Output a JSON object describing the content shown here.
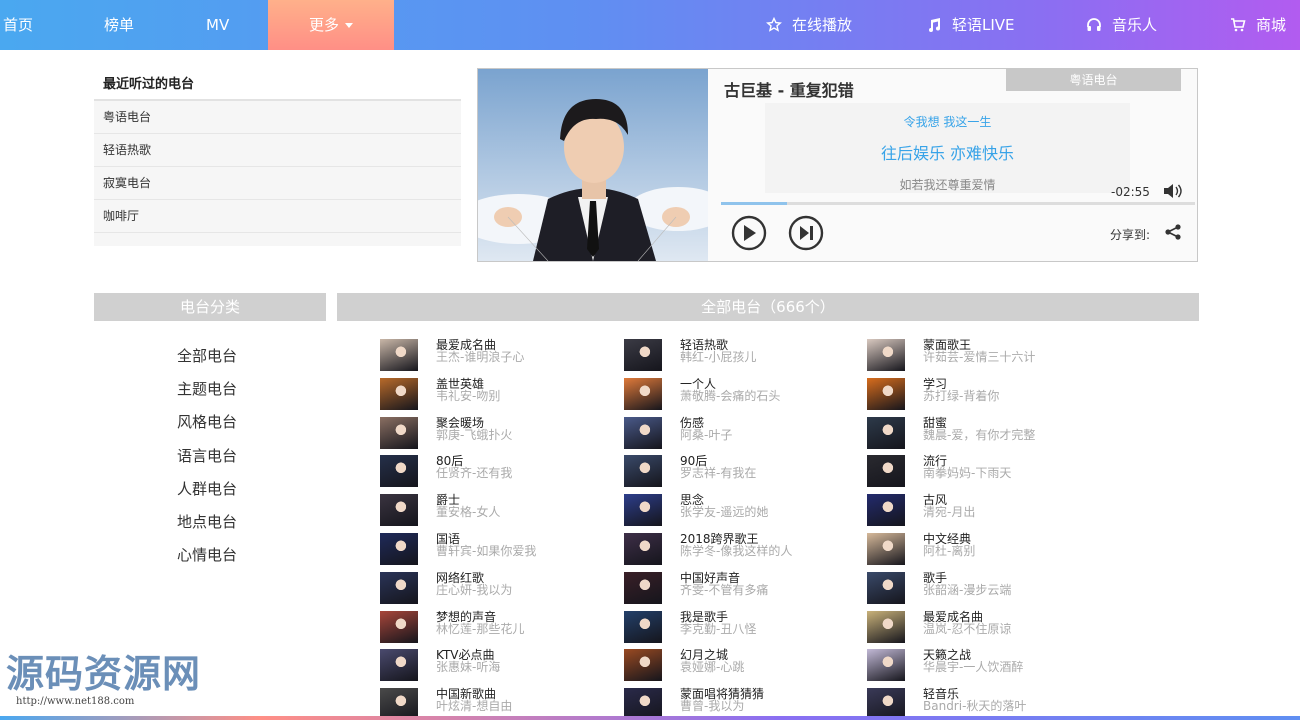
{
  "nav": {
    "home": "首页",
    "charts": "榜单",
    "mv": "MV",
    "more": "更多",
    "online": "在线播放",
    "live": "轻语LIVE",
    "musician": "音乐人",
    "mall": "商城"
  },
  "recent": {
    "title": "最近听过的电台",
    "items": [
      "粤语电台",
      "轻语热歌",
      "寂寞电台",
      "咖啡厅"
    ]
  },
  "player": {
    "song_title": "古巨基 - 重复犯错",
    "station_tag": "粤语电台",
    "lyric_line1": "令我想 我这一生",
    "lyric_line2": "往后娱乐 亦难快乐",
    "lyric_line3": "如若我还尊重爱情",
    "time_remaining": "-02:55",
    "progress_fraction": 0.14,
    "share_label": "分享到:"
  },
  "categories": {
    "title": "电台分类",
    "items": [
      "全部电台",
      "主题电台",
      "风格电台",
      "语言电台",
      "人群电台",
      "地点电台",
      "心情电台"
    ]
  },
  "stations": {
    "title": "全部电台（666个）",
    "items": [
      {
        "name": "最爱成名曲",
        "sub": "王杰-谁明浪子心",
        "tone": "#c9b7a8"
      },
      {
        "name": "轻语热歌",
        "sub": "韩红-小屁孩儿",
        "tone": "#3b3b45"
      },
      {
        "name": "蒙面歌王",
        "sub": "许茹芸-爱情三十六计",
        "tone": "#d9c9c0"
      },
      {
        "name": "盖世英雄",
        "sub": "韦礼安-吻别",
        "tone": "#b86a2a"
      },
      {
        "name": "一个人",
        "sub": "萧敬腾-会痛的石头",
        "tone": "#e07a3a"
      },
      {
        "name": "学习",
        "sub": "苏打绿-背着你",
        "tone": "#d86d1d"
      },
      {
        "name": "聚会暖场",
        "sub": "郭庚-飞蛾扑火",
        "tone": "#8a6f62"
      },
      {
        "name": "伤感",
        "sub": "阿桑-叶子",
        "tone": "#4a5a8a"
      },
      {
        "name": "甜蜜",
        "sub": "魏晨-爱，有你才完整",
        "tone": "#2d3a4a"
      },
      {
        "name": "80后",
        "sub": "任贤齐-还有我",
        "tone": "#25304a"
      },
      {
        "name": "90后",
        "sub": "罗志祥-有我在",
        "tone": "#3a4a6a"
      },
      {
        "name": "流行",
        "sub": "南拳妈妈-下雨天",
        "tone": "#2a2a30"
      },
      {
        "name": "爵士",
        "sub": "董安格-女人",
        "tone": "#3a3440"
      },
      {
        "name": "思念",
        "sub": "张学友-遥远的她",
        "tone": "#2d3e8c"
      },
      {
        "name": "古风",
        "sub": "清宛-月出",
        "tone": "#232b6e"
      },
      {
        "name": "国语",
        "sub": "曹轩宾-如果你爱我",
        "tone": "#1f2a5a"
      },
      {
        "name": "2018跨界歌王",
        "sub": "陈学冬-像我这样的人",
        "tone": "#3e2f48"
      },
      {
        "name": "中文经典",
        "sub": "阿杜-离别",
        "tone": "#d6b99a"
      },
      {
        "name": "网络红歌",
        "sub": "庄心妍-我以为",
        "tone": "#2a3458"
      },
      {
        "name": "中国好声音",
        "sub": "齐雯-不管有多痛",
        "tone": "#3a2028"
      },
      {
        "name": "歌手",
        "sub": "张韶涵-漫步云端",
        "tone": "#3a4a6a"
      },
      {
        "name": "梦想的声音",
        "sub": "林忆莲-那些花儿",
        "tone": "#a8463a"
      },
      {
        "name": "我是歌手",
        "sub": "李克勤-丑八怪",
        "tone": "#23406a"
      },
      {
        "name": "最爱成名曲",
        "sub": "温岚-忍不住原谅",
        "tone": "#c9b27a"
      },
      {
        "name": "KTV必点曲",
        "sub": "张惠妹-听海",
        "tone": "#4a4a6e"
      },
      {
        "name": "幻月之城",
        "sub": "袁娅娜-心跳",
        "tone": "#9a4a22"
      },
      {
        "name": "天籁之战",
        "sub": "华晨宇-一人饮酒醉",
        "tone": "#c2b9d6"
      },
      {
        "name": "中国新歌曲",
        "sub": "叶炫清-想自由",
        "tone": "#4a4a4a"
      },
      {
        "name": "蒙面唱将猜猜猜",
        "sub": "曹曾-我以为",
        "tone": "#2a2a4a"
      },
      {
        "name": "轻音乐",
        "sub": "Bandri-秋天的落叶",
        "tone": "#3a3a58"
      }
    ]
  },
  "watermark": {
    "title": "源码资源网",
    "url": "http://www.net188.com"
  },
  "colors": {
    "accent_blue": "#37a3e8",
    "nav_more": "#ff9f87",
    "header_gray": "#d0d0d0"
  }
}
